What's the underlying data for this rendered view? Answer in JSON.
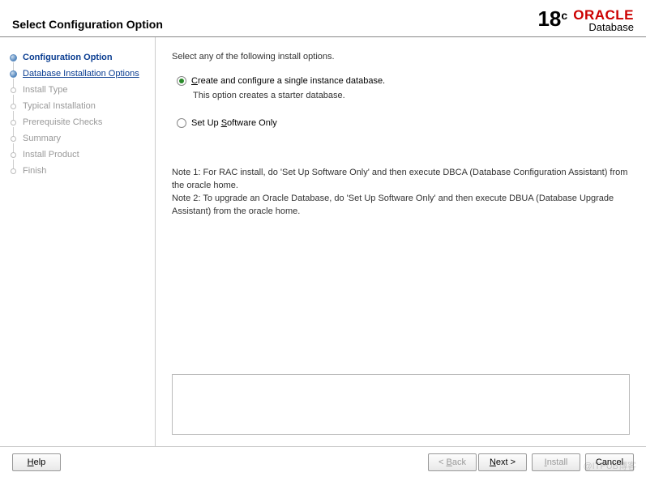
{
  "header": {
    "title": "Select Configuration Option",
    "logo_version": "18",
    "logo_version_suffix": "c",
    "logo_brand": "ORACLE",
    "logo_product": "Database"
  },
  "sidebar": {
    "steps": [
      {
        "label": "Configuration Option",
        "state": "active"
      },
      {
        "label": "Database Installation Options",
        "state": "link"
      },
      {
        "label": "Install Type",
        "state": "disabled"
      },
      {
        "label": "Typical Installation",
        "state": "disabled"
      },
      {
        "label": "Prerequisite Checks",
        "state": "disabled"
      },
      {
        "label": "Summary",
        "state": "disabled"
      },
      {
        "label": "Install Product",
        "state": "disabled"
      },
      {
        "label": "Finish",
        "state": "disabled"
      }
    ]
  },
  "main": {
    "intro": "Select any of the following install options.",
    "options": [
      {
        "mnemonic": "C",
        "label_rest": "reate and configure a single instance database.",
        "description": "This option creates a starter database.",
        "selected": true
      },
      {
        "prefix": "Set Up ",
        "mnemonic": "S",
        "label_rest": "oftware Only",
        "description": "",
        "selected": false
      }
    ],
    "note1": "Note 1: For RAC install, do 'Set Up Software Only' and then execute DBCA (Database Configuration Assistant) from the oracle home.",
    "note2": "Note 2: To upgrade an Oracle Database, do 'Set Up Software Only' and then execute DBUA (Database Upgrade Assistant) from the oracle home."
  },
  "footer": {
    "help_mnemonic": "H",
    "help_rest": "elp",
    "back_prefix": "< ",
    "back_mnemonic": "B",
    "back_rest": "ack",
    "next_mnemonic": "N",
    "next_rest": "ext >",
    "install_mnemonic": "I",
    "install_rest": "nstall",
    "cancel_label": "Cancel"
  },
  "watermark": "@ITPUB博客"
}
